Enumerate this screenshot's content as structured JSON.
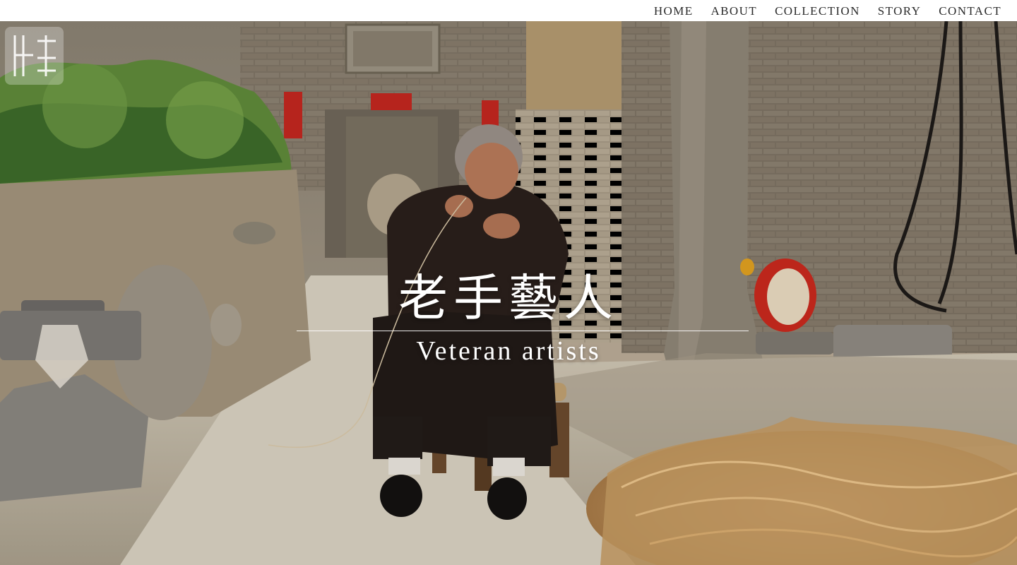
{
  "nav": {
    "items": [
      {
        "label": "HOME"
      },
      {
        "label": "ABOUT"
      },
      {
        "label": "COLLECTION"
      },
      {
        "label": "STORY"
      },
      {
        "label": "CONTACT"
      }
    ]
  },
  "hero": {
    "title_cn": "老手藝人",
    "title_en": "Veteran artists",
    "photo_icon": "artisan-weaving-photo"
  },
  "logo": {
    "icon": "site-logo-icon"
  },
  "colors": {
    "nav_background": "#ffffff",
    "nav_text": "#2b2b2b",
    "title_text": "#ffffff"
  }
}
